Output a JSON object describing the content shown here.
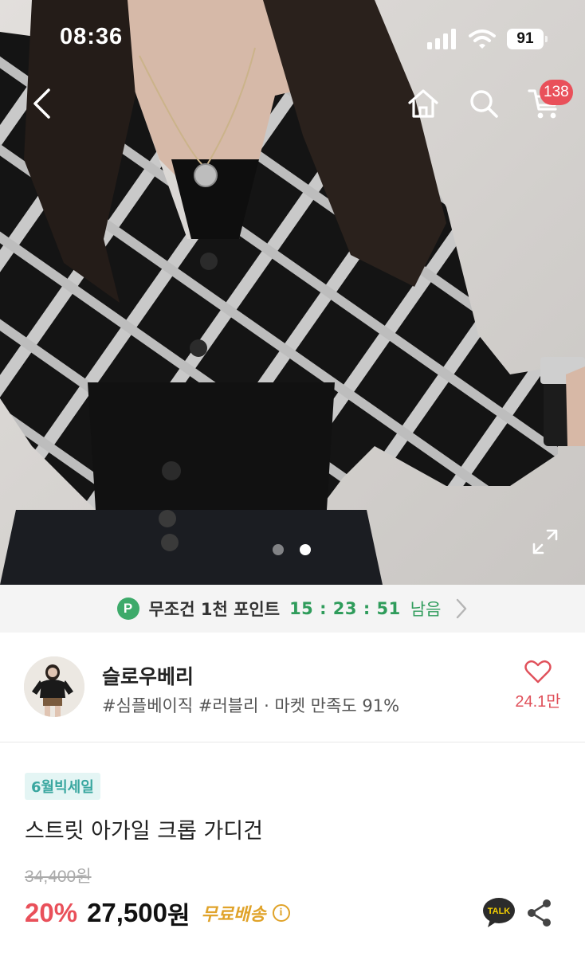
{
  "status_bar": {
    "time": "08:36",
    "battery": "91"
  },
  "header": {
    "cart_badge": "138"
  },
  "gallery": {
    "total_images": 2,
    "active_index": 2
  },
  "point_banner": {
    "badge": "P",
    "label": "무조건 1천 포인트",
    "timer": "15 : 23 : 51",
    "suffix": "남음"
  },
  "store": {
    "name": "슬로우베리",
    "tags": "#심플베이직 #러블리 · 마켓 만족도 91%",
    "like_count": "24.1만"
  },
  "product": {
    "event_badge": "6월빅세일",
    "title": "스트릿 아가일 크롭 가디건",
    "original_price": "34,400원",
    "discount": "20%",
    "price": "27,500",
    "price_unit": "원",
    "shipping": "무료배송",
    "info_icon": "i",
    "talk_label": "TALK"
  },
  "colors": {
    "accent_red": "#e9505a",
    "point_green": "#2f9c5b",
    "sale_teal": "#3aa7a0",
    "shipping_gold": "#e0a32a"
  }
}
